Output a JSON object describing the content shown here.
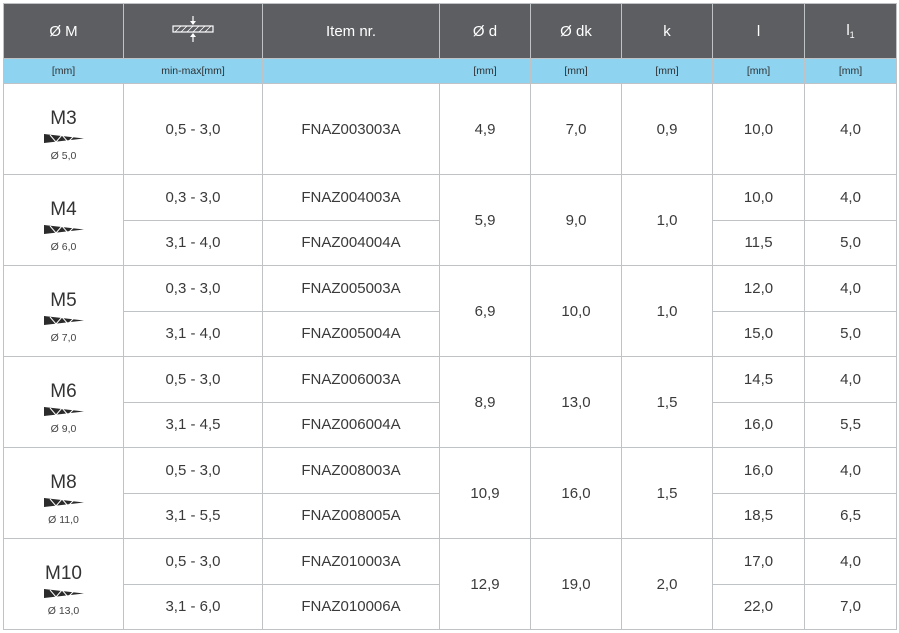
{
  "header": {
    "col_m": "Ø M",
    "col_grip_icon": "clamping-thickness-icon",
    "col_item": "Item nr.",
    "col_d": "Ø d",
    "col_dk": "Ø dk",
    "col_k": "k",
    "col_l": "l",
    "col_l1": "l",
    "col_l1_sub": "1"
  },
  "units": {
    "m": "[mm]",
    "grip": "min-max[mm]",
    "item": "",
    "d": "[mm]",
    "dk": "[mm]",
    "k": "[mm]",
    "l": "[mm]",
    "l1": "[mm]"
  },
  "sizes": [
    {
      "m": "M3",
      "drill": "Ø 5,0",
      "d": "4,9",
      "dk": "7,0",
      "k": "0,9",
      "rows": [
        {
          "grip": "0,5 - 3,0",
          "item": "FNAZ003003A",
          "l": "10,0",
          "l1": "4,0"
        }
      ]
    },
    {
      "m": "M4",
      "drill": "Ø 6,0",
      "d": "5,9",
      "dk": "9,0",
      "k": "1,0",
      "rows": [
        {
          "grip": "0,3 - 3,0",
          "item": "FNAZ004003A",
          "l": "10,0",
          "l1": "4,0"
        },
        {
          "grip": "3,1 - 4,0",
          "item": "FNAZ004004A",
          "l": "11,5",
          "l1": "5,0"
        }
      ]
    },
    {
      "m": "M5",
      "drill": "Ø 7,0",
      "d": "6,9",
      "dk": "10,0",
      "k": "1,0",
      "rows": [
        {
          "grip": "0,3 - 3,0",
          "item": "FNAZ005003A",
          "l": "12,0",
          "l1": "4,0"
        },
        {
          "grip": "3,1 - 4,0",
          "item": "FNAZ005004A",
          "l": "15,0",
          "l1": "5,0"
        }
      ]
    },
    {
      "m": "M6",
      "drill": "Ø 9,0",
      "d": "8,9",
      "dk": "13,0",
      "k": "1,5",
      "rows": [
        {
          "grip": "0,5 - 3,0",
          "item": "FNAZ006003A",
          "l": "14,5",
          "l1": "4,0"
        },
        {
          "grip": "3,1 - 4,5",
          "item": "FNAZ006004A",
          "l": "16,0",
          "l1": "5,5"
        }
      ]
    },
    {
      "m": "M8",
      "drill": "Ø 11,0",
      "d": "10,9",
      "dk": "16,0",
      "k": "1,5",
      "rows": [
        {
          "grip": "0,5 - 3,0",
          "item": "FNAZ008003A",
          "l": "16,0",
          "l1": "4,0"
        },
        {
          "grip": "3,1 - 5,5",
          "item": "FNAZ008005A",
          "l": "18,5",
          "l1": "6,5"
        }
      ]
    },
    {
      "m": "M10",
      "drill": "Ø 13,0",
      "d": "12,9",
      "dk": "19,0",
      "k": "2,0",
      "rows": [
        {
          "grip": "0,5 - 3,0",
          "item": "FNAZ010003A",
          "l": "17,0",
          "l1": "4,0"
        },
        {
          "grip": "3,1 - 6,0",
          "item": "FNAZ010006A",
          "l": "22,0",
          "l1": "7,0"
        }
      ]
    }
  ],
  "colors": {
    "header_bg": "#5c5e61",
    "units_bg": "#8ed3ef",
    "grid": "#bfc3c6",
    "drill_icon": "#2b2b2b"
  }
}
